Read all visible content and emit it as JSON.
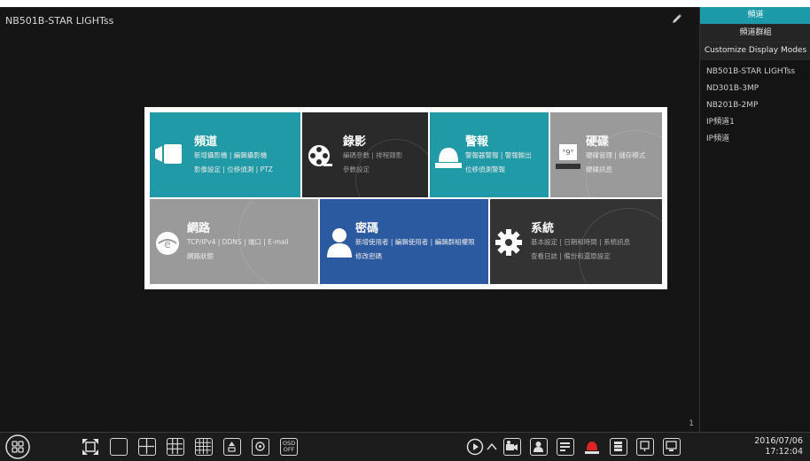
{
  "screen": {
    "camera_title": "NB501B-STAR LIGHTss",
    "page_number": "1"
  },
  "right_panel": {
    "tabs": [
      {
        "label": "頻道"
      },
      {
        "label": "頻道群組"
      },
      {
        "label": "Customize Display Modes"
      }
    ],
    "items": [
      {
        "label": "NB501B-STAR LIGHTss"
      },
      {
        "label": "ND301B-3MP"
      },
      {
        "label": "NB201B-2MP"
      },
      {
        "label": "IP頻道1"
      },
      {
        "label": "IP頻道"
      }
    ]
  },
  "menu": {
    "channel": {
      "title": "頻道",
      "line1": "新增攝影機 | 編輯攝影機",
      "line2": "影像設定 | 位移偵測 | PTZ"
    },
    "record": {
      "title": "錄影",
      "line1": "編碼參數 | 排程錄影",
      "line2": "參數設定"
    },
    "alarm": {
      "title": "警報",
      "line1": "警報器警報 | 警報輸出",
      "line2": "位移偵測警報"
    },
    "disk": {
      "title": "硬碟",
      "line1": "硬碟管理 | 儲存模式",
      "line2": "硬碟訊息"
    },
    "network": {
      "title": "網路",
      "line1": "TCP/IPv4 | DDNS | 端口 | E-mail",
      "line2": "網路狀態"
    },
    "account": {
      "title": "密碼",
      "line1": "新增使用者 | 編輯使用者 | 編輯群組權限",
      "line2": "修改密碼"
    },
    "system": {
      "title": "系統",
      "line1": "基本設定 | 日期和時間 | 系統訊息",
      "line2": "查看日誌 | 備份和還原設定"
    }
  },
  "taskbar": {
    "osd_line1": "OSD",
    "osd_line2": "OFF",
    "date": "2016/07/06",
    "time": "17:12:04"
  }
}
